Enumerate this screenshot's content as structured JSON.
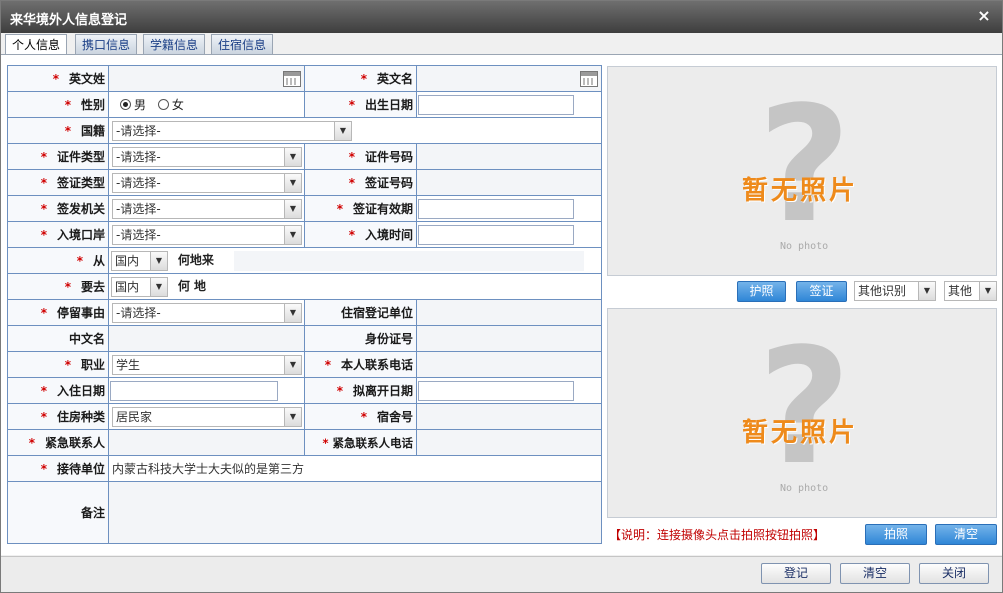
{
  "window": {
    "title": "来华境外人信息登记",
    "close_glyph": "×"
  },
  "tabs": [
    "个人信息",
    "携口信息",
    "学籍信息",
    "住宿信息"
  ],
  "form": {
    "required_mark": "*",
    "surname_en": "英文姓",
    "given_en": "英文名",
    "gender": "性别",
    "gender_male": "男",
    "gender_female": "女",
    "birth_date": "出生日期",
    "nationality": "国籍",
    "id_type": "证件类型",
    "id_number": "证件号码",
    "visa_type": "签证类型",
    "visa_number": "签证号码",
    "issuing_authority": "签发机关",
    "visa_validity": "签证有效期",
    "entry_port": "入境口岸",
    "entry_time": "入境时间",
    "from_label": "从",
    "from_value": "国内",
    "from_suffix": "何地来",
    "goto_label": "要去",
    "goto_value": "国内",
    "goto_suffix": "何 地",
    "stay_reason": "停留事由",
    "lodging_unit": "住宿登记单位",
    "chinese_name": "中文名",
    "id_card_no": "身份证号",
    "occupation": "职业",
    "occupation_value": "学生",
    "own_phone": "本人联系电话",
    "checkin_date": "入住日期",
    "planned_leave_date": "拟离开日期",
    "housing_type": "住房种类",
    "housing_type_value": "居民家",
    "dorm_no": "宿舍号",
    "emergency_contact": "紧急联系人",
    "emergency_phone": "紧急联系人电话",
    "host_unit": "接待单位",
    "host_unit_value": "内蒙古科技大学士大夫似的是第三方",
    "remarks": "备注",
    "select_placeholder": "-请选择-"
  },
  "photo": {
    "no_photo": "暂无照片",
    "no_photo_en": "No photo"
  },
  "scan_buttons": {
    "passport": "护照",
    "visa": "签证",
    "other_recog": "其他识别",
    "other": "其他"
  },
  "camera": {
    "note": "【说明：连接摄像头点击拍照按钮拍照】",
    "shoot": "拍照",
    "clear": "清空"
  },
  "footer": {
    "register": "登记",
    "clear": "清空",
    "close": "关闭"
  }
}
